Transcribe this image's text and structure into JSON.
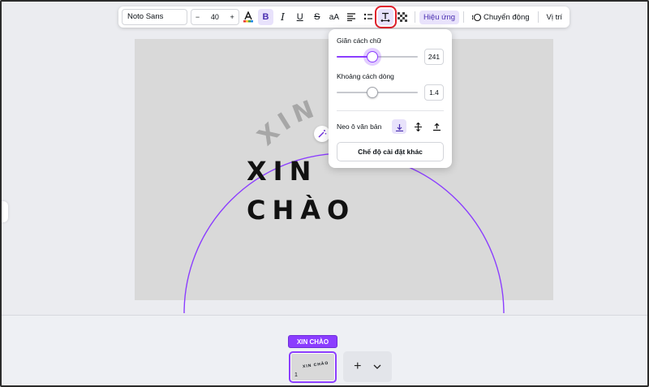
{
  "toolbar": {
    "font_family": "Noto Sans",
    "font_size": "40",
    "decrease": "−",
    "increase": "+",
    "effects_label": "Hiệu ứng",
    "animate_label": "Chuyển động",
    "position_label": "Vị trí"
  },
  "popover": {
    "letter_spacing_label": "Giãn cách chữ",
    "letter_spacing_value": "241",
    "letter_spacing_fraction": 0.44,
    "line_spacing_label": "Khoảng cách dòng",
    "line_spacing_value": "1.4",
    "line_spacing_fraction": 0.44,
    "anchor_label": "Neo ô văn bản",
    "more_settings_label": "Chế độ cài đặt khác"
  },
  "canvas": {
    "line1": "XIN",
    "line2": "CHÀO",
    "curved_text": "XIN CHÀO"
  },
  "pages": {
    "tag_label": "XIN CHÀO",
    "page_number": "1",
    "thumb_text": "XIN CHÀO",
    "add_symbol": "+"
  },
  "colors": {
    "accent": "#8b3dff",
    "highlight_box": "#e0202c"
  }
}
